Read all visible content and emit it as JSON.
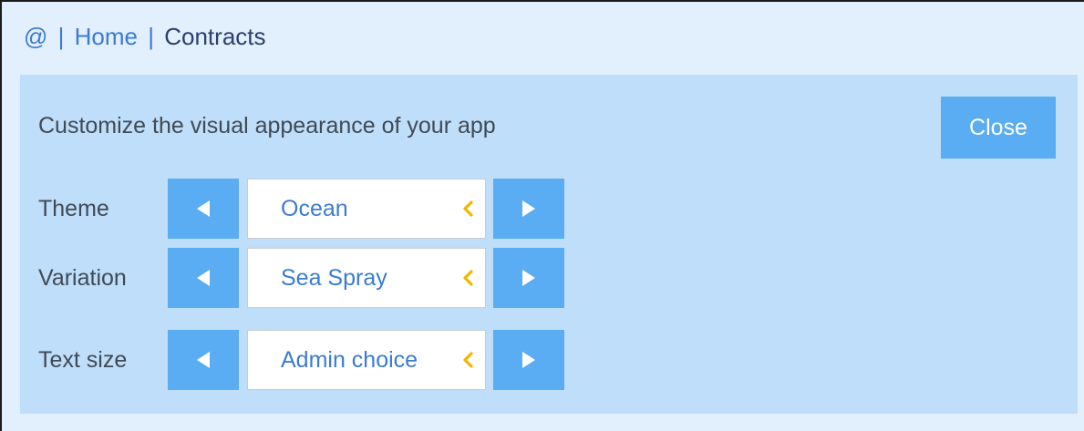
{
  "breadcrumb": {
    "root": "@",
    "separator": "|",
    "home": "Home",
    "current": "Contracts"
  },
  "panel": {
    "title": "Customize the visual appearance of your app",
    "close_label": "Close"
  },
  "settings": [
    {
      "label": "Theme",
      "value": "Ocean"
    },
    {
      "label": "Variation",
      "value": "Sea Spray"
    },
    {
      "label": "Text size",
      "value": "Admin choice"
    }
  ],
  "icons": {
    "prev": "triangle-left-icon",
    "next": "triangle-right-icon",
    "indicator": "chevron-left-icon"
  },
  "colors": {
    "page_background": "#e2f0fd",
    "panel_background": "#bfdefa",
    "accent": "#5aacf3",
    "link": "#3c7bd4",
    "indicator": "#f2b600"
  }
}
